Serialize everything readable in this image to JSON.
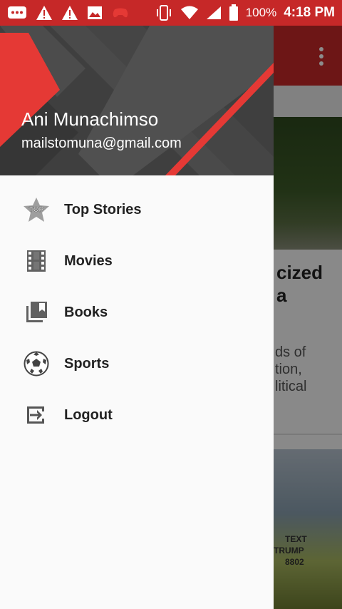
{
  "status_bar": {
    "battery": "100%",
    "time": "4:18 PM",
    "left_icons": [
      "messages-icon",
      "warning-icon",
      "warning-icon",
      "image-icon",
      "controller-icon"
    ],
    "right_icons": [
      "vibrate-icon",
      "wifi-icon",
      "signal-icon",
      "battery-icon"
    ],
    "color": "#c62828"
  },
  "drawer": {
    "header": {
      "name": "Ani Munachimso",
      "email": "mailstomuna@gmail.com",
      "accent_color": "#e53935",
      "background_color": "#3f3f3f"
    },
    "items": [
      {
        "label": "Top Stories",
        "icon": "top-badge-icon"
      },
      {
        "label": "Movies",
        "icon": "film-strip-icon"
      },
      {
        "label": "Books",
        "icon": "library-books-icon"
      },
      {
        "label": "Sports",
        "icon": "soccer-ball-icon"
      },
      {
        "label": "Logout",
        "icon": "exit-icon"
      }
    ]
  },
  "background_content": {
    "card_title_fragments": [
      "cized",
      "a"
    ],
    "card_body_fragments": [
      "ds of",
      "tion,",
      "litical"
    ],
    "shirt_text": [
      "TEXT",
      "TRUMP",
      "8802"
    ]
  }
}
